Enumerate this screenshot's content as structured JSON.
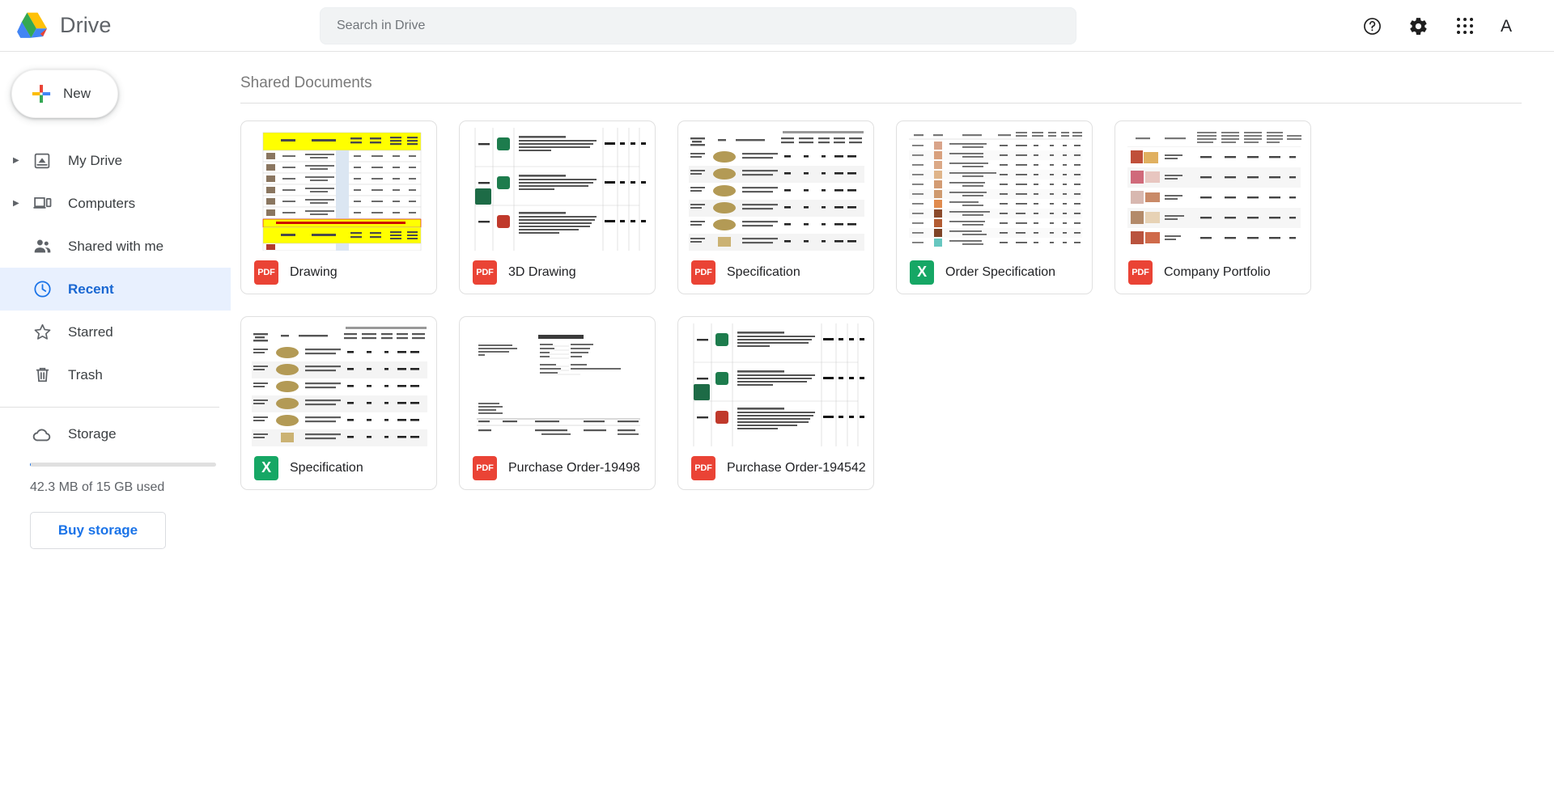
{
  "header": {
    "app_title": "Drive",
    "logo_icon": "drive-logo",
    "search": {
      "placeholder": "Search in Drive",
      "value": ""
    },
    "actions": [
      {
        "name": "help-icon",
        "label": "Help"
      },
      {
        "name": "settings-gear-icon",
        "label": "Settings"
      },
      {
        "name": "google-apps-icon",
        "label": "Google apps"
      }
    ],
    "avatar_letter": "A"
  },
  "sidebar": {
    "new_button": {
      "label": "New",
      "icon": "plus-icon"
    },
    "items": [
      {
        "label": "My Drive",
        "icon": "my-drive-icon",
        "expandable": true,
        "active": false
      },
      {
        "label": "Computers",
        "icon": "computers-icon",
        "expandable": true,
        "active": false
      },
      {
        "label": "Shared with me",
        "icon": "shared-with-me-icon",
        "expandable": false,
        "active": false
      },
      {
        "label": "Recent",
        "icon": "recent-clock-icon",
        "expandable": false,
        "active": true
      },
      {
        "label": "Starred",
        "icon": "star-icon",
        "expandable": false,
        "active": false
      },
      {
        "label": "Trash",
        "icon": "trash-icon",
        "expandable": false,
        "active": false
      }
    ],
    "storage": {
      "label": "Storage",
      "icon": "cloud-icon",
      "used_text": "42.3 MB of 15 GB used",
      "used_percent": 0.3,
      "buy_button_label": "Buy storage"
    }
  },
  "main": {
    "section_title": "Shared Documents",
    "files": [
      {
        "name": "Drawing",
        "type": "pdf",
        "type_label": "PDF",
        "thumb": "price-list-yellow-table"
      },
      {
        "name": "3D Drawing",
        "type": "pdf",
        "type_label": "PDF",
        "thumb": "product-description-sheet"
      },
      {
        "name": "Specification",
        "type": "pdf",
        "type_label": "PDF",
        "thumb": "spec-table-cans"
      },
      {
        "name": "Order Specification",
        "type": "xls",
        "type_label": "X",
        "thumb": "order-table-dense"
      },
      {
        "name": "Company Portfolio",
        "type": "pdf",
        "type_label": "PDF",
        "thumb": "portfolio-gift-baskets"
      },
      {
        "name": "Specification",
        "type": "xls",
        "type_label": "X",
        "thumb": "spec-table-cans"
      },
      {
        "name": "Purchase Order-19498",
        "type": "pdf",
        "type_label": "PDF",
        "thumb": "purchase-order-doc"
      },
      {
        "name": "Purchase Order-194542",
        "type": "pdf",
        "type_label": "PDF",
        "thumb": "product-description-sheet"
      }
    ]
  },
  "colors": {
    "accent_blue": "#1a73e8",
    "active_bg": "#e8f0fe",
    "pdf_red": "#ea4335",
    "sheet_green": "#16a765",
    "text_primary": "#202124",
    "text_secondary": "#5f6368"
  }
}
